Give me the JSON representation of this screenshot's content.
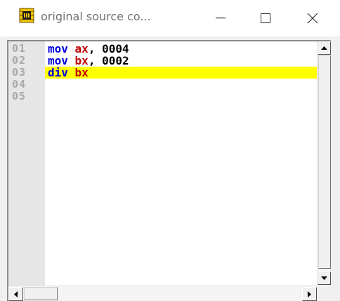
{
  "window": {
    "title": "original source co...",
    "icon": "chip-icon",
    "controls": [
      "minimize-icon",
      "maximize-icon",
      "close-icon"
    ]
  },
  "editor": {
    "line_numbers": [
      "01",
      "02",
      "03",
      "04",
      "05"
    ],
    "lines": [
      {
        "mnemonic": "mov",
        "sep": " ",
        "operand": "ax",
        "comma": ",",
        "value": " 0004",
        "highlighted": false
      },
      {
        "mnemonic": "mov",
        "sep": " ",
        "operand": "bx",
        "comma": ",",
        "value": " 0002",
        "highlighted": false
      },
      {
        "mnemonic": "div",
        "sep": " ",
        "operand": "bx",
        "comma": "",
        "value": "",
        "highlighted": true
      }
    ],
    "colors": {
      "keyword": "#0000e0",
      "register": "#c00000",
      "number": "#000000",
      "highlight": "#ffff00"
    }
  },
  "scrollbars": {
    "vertical": [
      "scroll-up-icon",
      "scroll-down-icon"
    ],
    "horizontal": [
      "scroll-left-icon",
      "scroll-right-icon"
    ]
  }
}
